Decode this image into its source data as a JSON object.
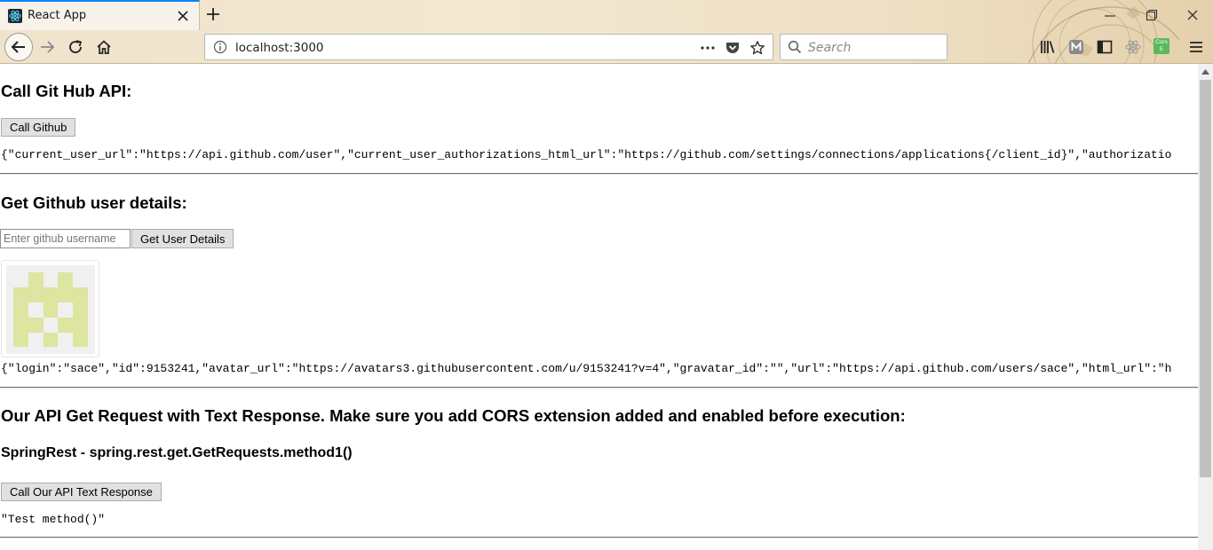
{
  "browser": {
    "tab_title": "React App",
    "url": "localhost:3000",
    "search_placeholder": "Search",
    "cors_badge": "Cors E",
    "colors": {
      "tab_accent": "#0a84ff",
      "chrome_bg": "#efe3cc"
    },
    "icons": [
      "react-favicon",
      "close-icon",
      "plus-icon",
      "minimize-icon",
      "restore-icon",
      "back-icon",
      "forward-icon",
      "reload-icon",
      "home-icon",
      "info-icon",
      "more-icon",
      "pocket-icon",
      "star-icon",
      "search-icon",
      "library-icon",
      "extension-icon",
      "sidebar-icon",
      "react-devtools-icon",
      "hamburger-menu-icon"
    ]
  },
  "github_api": {
    "heading": "Call Git Hub API:",
    "button": "Call Github",
    "response": "{\"current_user_url\":\"https://api.github.com/user\",\"current_user_authorizations_html_url\":\"https://github.com/settings/connections/applications{/client_id}\",\"authorizatio"
  },
  "user_details": {
    "heading": "Get Github user details:",
    "input_placeholder": "Enter github username",
    "input_value": "",
    "button": "Get User Details",
    "response": "{\"login\":\"sace\",\"id\":9153241,\"avatar_url\":\"https://avatars3.githubusercontent.com/u/9153241?v=4\",\"gravatar_id\":\"\",\"url\":\"https://api.github.com/users/sace\",\"html_url\":\"h",
    "avatar_color": "#dde5a0"
  },
  "our_api": {
    "heading": "Our API Get Request with Text Response. Make sure you add CORS extension added and enabled before execution:",
    "subheading": "SpringRest - spring.rest.get.GetRequests.method1()",
    "button": "Call Our API Text Response",
    "response": "\"Test method()\""
  }
}
